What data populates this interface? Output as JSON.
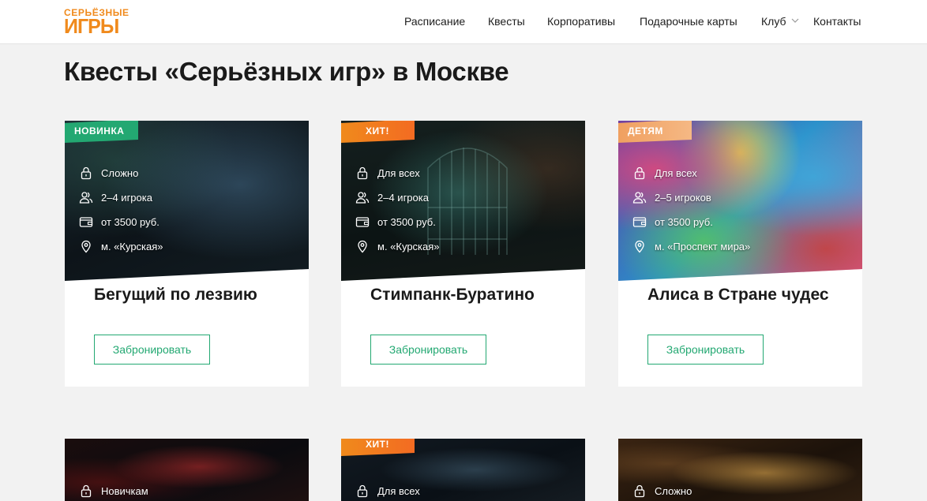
{
  "logo": {
    "line1": "СЕРЬЁЗНЫЕ",
    "line2": "ИГРЫ"
  },
  "nav": {
    "items": [
      "Расписание",
      "Квесты",
      "Корпоративы",
      "Подарочные карты",
      "Клуб",
      "Контакты"
    ]
  },
  "page": {
    "title": "Квесты «Серьёзных игр» в Москве"
  },
  "book_label": "Забронировать",
  "cards": [
    {
      "tag": "НОВИНКА",
      "difficulty": "Сложно",
      "players": "2–4 игрока",
      "price": "от 3500 руб.",
      "metro": "м. «Курская»",
      "title": "Бегущий по лезвию"
    },
    {
      "tag": "ХИТ!",
      "difficulty": "Для всех",
      "players": "2–4 игрока",
      "price": "от 3500 руб.",
      "metro": "м. «Курская»",
      "title": "Стимпанк-Буратино"
    },
    {
      "tag": "ДЕТЯМ",
      "difficulty": "Для всех",
      "players": "2–5 игроков",
      "price": "от 3500 руб.",
      "metro": "м. «Проспект мира»",
      "title": "Алиса в Стране чудес"
    },
    {
      "difficulty": "Новичкам"
    },
    {
      "tag": "ХИТ!",
      "difficulty": "Для всех"
    },
    {
      "difficulty": "Сложно"
    }
  ],
  "colors": {
    "accent_green": "#23a872",
    "accent_orange": "#f08a1c",
    "background": "#f2f2f2"
  }
}
